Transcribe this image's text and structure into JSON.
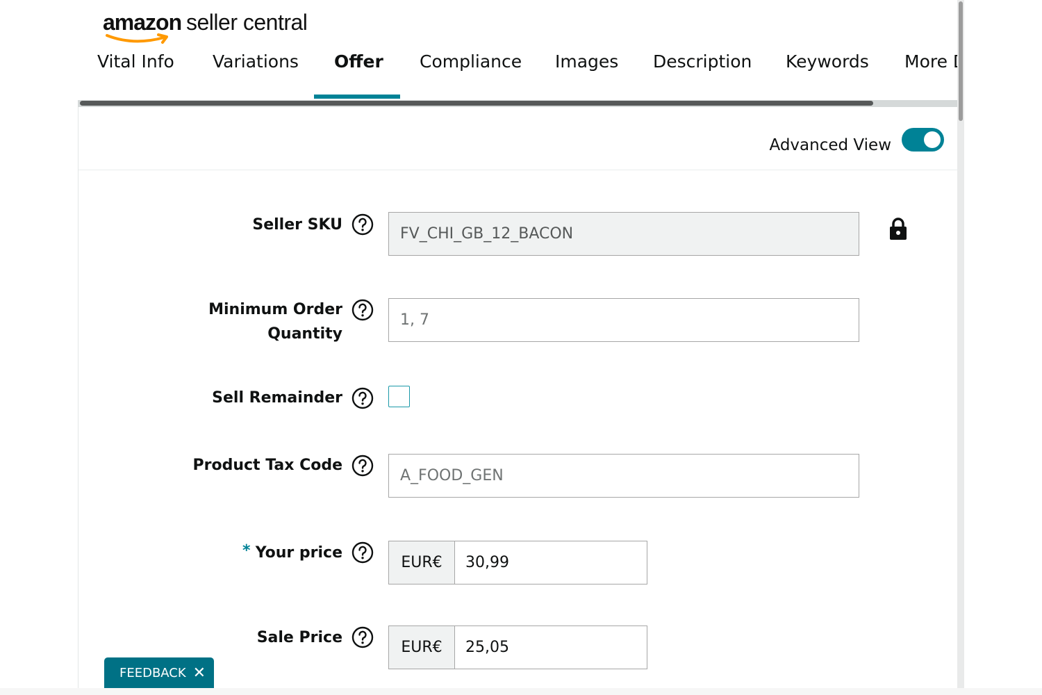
{
  "logo": {
    "brand": "amazon",
    "product": "seller central"
  },
  "tabs": [
    {
      "label": "Vital Info"
    },
    {
      "label": "Variations"
    },
    {
      "label": "Offer",
      "active": true
    },
    {
      "label": "Compliance"
    },
    {
      "label": "Images"
    },
    {
      "label": "Description"
    },
    {
      "label": "Keywords"
    },
    {
      "label": "More D"
    }
  ],
  "header": {
    "advanced_view_label": "Advanced View",
    "advanced_view_on": true
  },
  "form": {
    "seller_sku": {
      "label": "Seller SKU",
      "value": "FV_CHI_GB_12_BACON",
      "locked": true
    },
    "min_order": {
      "label_line1": "Minimum Order",
      "label_line2": "Quantity",
      "value": "1, 7"
    },
    "sell_remainder": {
      "label": "Sell Remainder",
      "checked": false
    },
    "tax_code": {
      "label": "Product Tax Code",
      "value": "A_FOOD_GEN"
    },
    "your_price": {
      "required_mark": "*",
      "label": "Your price",
      "currency": "EUR€",
      "value": "30,99"
    },
    "sale_price": {
      "label": "Sale Price",
      "currency": "EUR€",
      "value": "25,05"
    }
  },
  "feedback": {
    "label": "FEEDBACK",
    "close": "✕"
  },
  "colors": {
    "accent": "#008296",
    "feedback": "#007185"
  },
  "icons": {
    "help": "question-circle-icon",
    "lock": "lock-icon",
    "close": "close-icon"
  }
}
